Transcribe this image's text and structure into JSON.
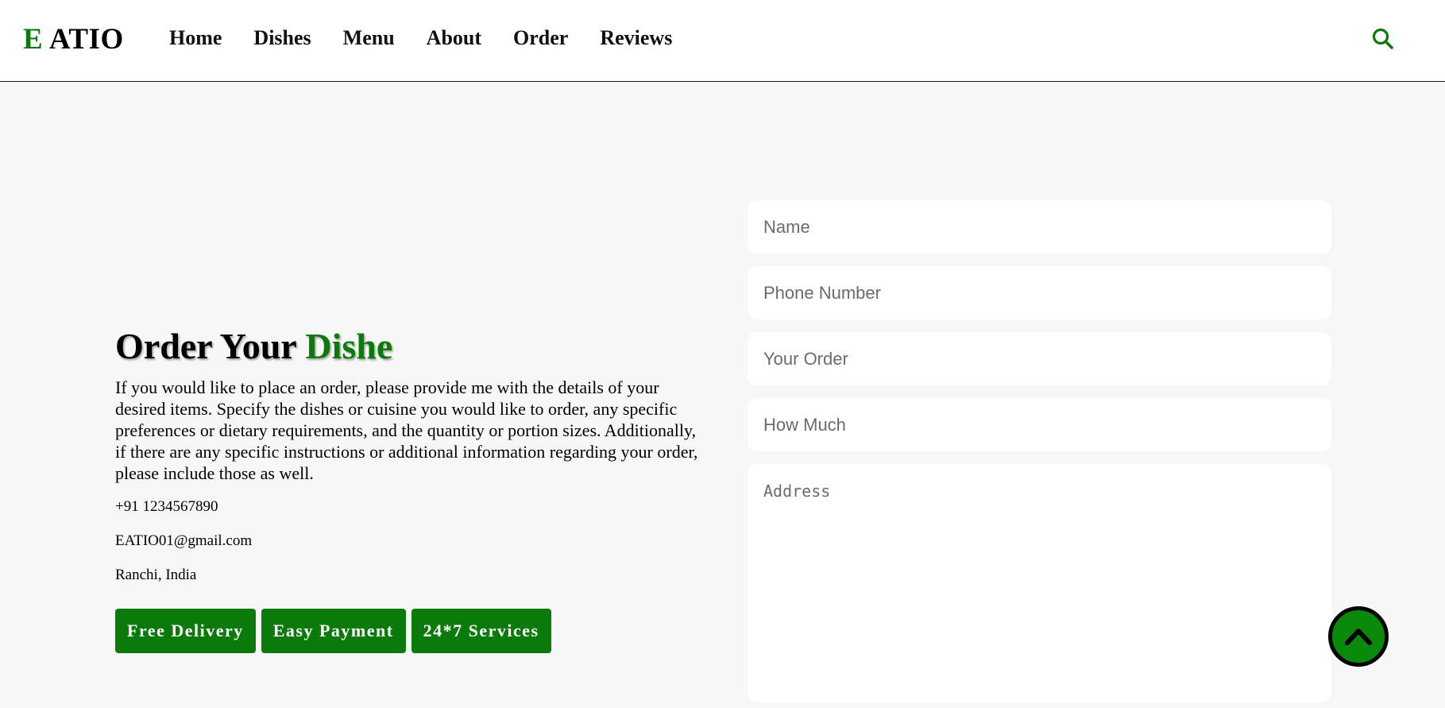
{
  "brand": {
    "logo_first": "E",
    "logo_rest": " ATIO"
  },
  "nav": {
    "items": [
      "Home",
      "Dishes",
      "Menu",
      "About",
      "Order",
      "Reviews"
    ]
  },
  "hero": {
    "title_main": "Order Your ",
    "title_accent": "Dishe",
    "description": "If you would like to place an order, please provide me with the details of your desired items. Specify the dishes or cuisine you would like to order, any specific preferences or dietary requirements, and the quantity or portion sizes. Additionally, if there are any specific instructions or additional information regarding your order, please include those as well.",
    "phone": "+91 1234567890",
    "email": "EATIO01@gmail.com",
    "location": "Ranchi, India",
    "badges": [
      "Free Delivery",
      "Easy Payment",
      "24*7 Services"
    ]
  },
  "form": {
    "name_placeholder": "Name",
    "phone_placeholder": "Phone Number",
    "order_placeholder": "Your Order",
    "quantity_placeholder": "How Much",
    "address_placeholder": "Address"
  },
  "icons": {
    "search": "search-icon",
    "scroll_top": "chevron-up-icon"
  },
  "colors": {
    "accent": "#0a7a0a",
    "background": "#f7f7f7",
    "navbar": "#ffffff"
  }
}
